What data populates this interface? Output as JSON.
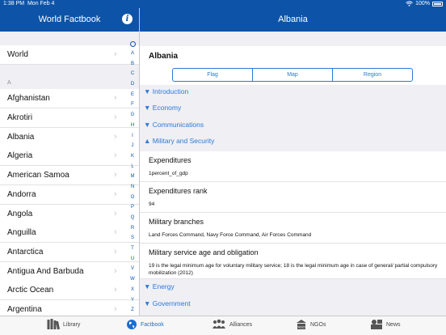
{
  "status": {
    "time": "1:38 PM",
    "date": "Mon Feb 4",
    "battery": "100%"
  },
  "left_nav": {
    "title": "World Factbook"
  },
  "right_nav": {
    "title": "Albania"
  },
  "left_list": {
    "top_item": "World",
    "section_header": "A",
    "items": [
      "Afghanistan",
      "Akrotiri",
      "Albania",
      "Algeria",
      "American Samoa",
      "Andorra",
      "Angola",
      "Anguilla",
      "Antarctica",
      "Antigua And Barbuda",
      "Arctic Ocean",
      "Argentina"
    ],
    "index": [
      "A",
      "B",
      "C",
      "D",
      "E",
      "F",
      "G",
      "H",
      "I",
      "J",
      "K",
      "L",
      "M",
      "N",
      "O",
      "P",
      "Q",
      "R",
      "S",
      "T",
      "U",
      "V",
      "W",
      "X",
      "Y",
      "Z"
    ]
  },
  "detail": {
    "country": "Albania",
    "segments": [
      "Flag",
      "Map",
      "Region"
    ],
    "sections_collapsed": [
      "Introduction",
      "Economy",
      "Communications"
    ],
    "expanded_section": "Military and Security",
    "items": [
      {
        "key": "Expenditures",
        "value": "1percent_of_gdp"
      },
      {
        "key": "Expenditures rank",
        "value": "94"
      },
      {
        "key": "Military branches",
        "value": "Land Forces Command, Navy Force Command, Air Forces Command"
      },
      {
        "key": "Military service age and obligation",
        "value": "19 is the legal minimum age for voluntary military service; 18 is the legal minimum age in case of general/ partial compulsory mobilization (2012)"
      }
    ],
    "sections_after": [
      "Energy",
      "Government"
    ]
  },
  "tabs": [
    {
      "label": "Library",
      "icon": "library-icon"
    },
    {
      "label": "Factbook",
      "icon": "globe-icon",
      "active": true
    },
    {
      "label": "Alliances",
      "icon": "people-icon"
    },
    {
      "label": "NGOs",
      "icon": "ngo-icon"
    },
    {
      "label": "News",
      "icon": "news-icon"
    }
  ],
  "colors": {
    "nav": "#0d54a8",
    "accent": "#2d7ad6",
    "background": "#efeff4"
  }
}
